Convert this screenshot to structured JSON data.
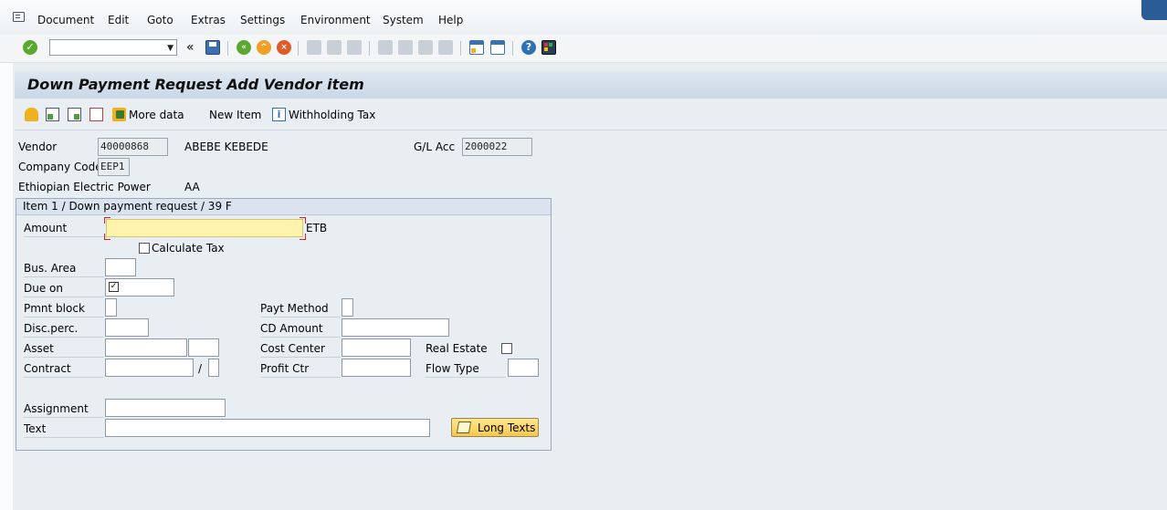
{
  "menu": {
    "items": [
      "Document",
      "Edit",
      "Goto",
      "Extras",
      "Settings",
      "Environment",
      "System",
      "Help"
    ]
  },
  "toolbar": {
    "command_field_value": "",
    "back_glyph": "«",
    "icons": [
      "enter-icon",
      "save-icon",
      "back-icon",
      "exit-icon",
      "cancel-icon",
      "print-icon",
      "find-icon",
      "find-next-icon",
      "first-page-icon",
      "prev-page-icon",
      "next-page-icon",
      "last-page-icon",
      "new-session-icon",
      "shortcut-icon",
      "help-icon",
      "customize-layout-icon"
    ]
  },
  "title": "Down Payment Request Add Vendor item",
  "app_toolbar": {
    "more_data": "More data",
    "new_item": "New Item",
    "withholding_tax": "Withholding Tax"
  },
  "header": {
    "vendor_label": "Vendor",
    "vendor_value": "40000868",
    "vendor_name": "ABEBE KEBEDE",
    "gl_acc_label": "G/L Acc",
    "gl_acc_value": "2000022",
    "company_code_label": "Company Code",
    "company_code_value": "EEP1",
    "company_name": "Ethiopian Electric Power",
    "city": "AA"
  },
  "item": {
    "group_title": "Item 1 / Down payment request / 39 F",
    "amount_label": "Amount",
    "amount_value": "",
    "currency": "ETB",
    "calculate_tax_label": "Calculate Tax",
    "calculate_tax_checked": false,
    "bus_area_label": "Bus. Area",
    "due_on_label": "Due on",
    "pmnt_block_label": "Pmnt block",
    "payt_method_label": "Payt Method",
    "disc_perc_label": "Disc.perc.",
    "cd_amount_label": "CD Amount",
    "asset_label": "Asset",
    "cost_center_label": "Cost Center",
    "real_estate_label": "Real Estate",
    "real_estate_checked": false,
    "contract_label": "Contract",
    "contract_sep": "/",
    "profit_ctr_label": "Profit Ctr",
    "flow_type_label": "Flow Type",
    "assignment_label": "Assignment",
    "text_label": "Text",
    "long_texts_label": "Long Texts"
  },
  "colors": {
    "background": "#e9eef3",
    "title_bar": "#c9d7e5",
    "required_field": "#fff3ad",
    "long_texts_button": "#f5c84a"
  }
}
